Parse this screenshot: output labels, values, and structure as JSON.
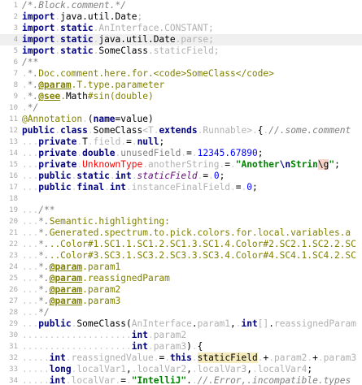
{
  "editor": {
    "current_line": 4,
    "lines": [
      {
        "n": "1",
        "tokens": [
          [
            "c-cmt",
            "/*.Block.comment.*/"
          ]
        ]
      },
      {
        "n": "2",
        "tokens": [
          [
            "c-kw",
            "import"
          ],
          [
            "c-dots",
            "."
          ],
          [
            "c-plain",
            "java.util.Date"
          ],
          [
            "c-fade",
            ";"
          ]
        ]
      },
      {
        "n": "3",
        "tokens": [
          [
            "c-kw",
            "import"
          ],
          [
            "c-dots",
            "."
          ],
          [
            "c-kw",
            "static"
          ],
          [
            "c-dots",
            "."
          ],
          [
            "c-fade",
            "AnInterface.CONSTANT;"
          ]
        ]
      },
      {
        "n": "4",
        "tokens": [
          [
            "c-kw",
            "import"
          ],
          [
            "c-dots",
            "."
          ],
          [
            "c-kw",
            "static"
          ],
          [
            "c-dots",
            "."
          ],
          [
            "c-plain",
            "java.util.Date"
          ],
          [
            "c-fade",
            "."
          ],
          [
            "c-fade",
            "parse;"
          ]
        ]
      },
      {
        "n": "5",
        "tokens": [
          [
            "c-kw",
            "import"
          ],
          [
            "c-dots",
            "."
          ],
          [
            "c-kw",
            "static"
          ],
          [
            "c-dots",
            "."
          ],
          [
            "c-plain",
            "SomeClass"
          ],
          [
            "c-fade",
            "."
          ],
          [
            "c-fade",
            "staticField;"
          ]
        ]
      },
      {
        "n": "6",
        "tokens": [
          [
            "c-cmt",
            "/**"
          ]
        ]
      },
      {
        "n": "7",
        "tokens": [
          [
            "c-dots",
            "."
          ],
          [
            "c-cmt",
            "*."
          ],
          [
            "c-doc",
            "Doc.comment.here.for.<code>SomeClass</code>"
          ]
        ]
      },
      {
        "n": "8",
        "tokens": [
          [
            "c-dots",
            "."
          ],
          [
            "c-cmt",
            "*."
          ],
          [
            "c-doctag",
            "@param"
          ],
          [
            "c-doc",
            "."
          ],
          [
            "c-doc",
            "T.type.parameter"
          ]
        ]
      },
      {
        "n": "9",
        "tokens": [
          [
            "c-dots",
            "."
          ],
          [
            "c-cmt",
            "*."
          ],
          [
            "c-doctag",
            "@see"
          ],
          [
            "c-doc",
            "."
          ],
          [
            "c-plain",
            "Math"
          ],
          [
            "c-doc",
            "#"
          ],
          [
            "c-doc",
            "sin(double)"
          ]
        ]
      },
      {
        "n": "10",
        "tokens": [
          [
            "c-dots",
            "."
          ],
          [
            "c-cmt",
            "*/"
          ]
        ]
      },
      {
        "n": "11",
        "tokens": [
          [
            "c-anno",
            "@Annotation"
          ],
          [
            "c-dots",
            "."
          ],
          [
            "c-plain",
            "("
          ],
          [
            "c-kw",
            "name"
          ],
          [
            "c-plain",
            "=value)"
          ]
        ]
      },
      {
        "n": "12",
        "tokens": [
          [
            "c-kw",
            "public"
          ],
          [
            "c-dots",
            "."
          ],
          [
            "c-kw",
            "class"
          ],
          [
            "c-dots",
            "."
          ],
          [
            "c-plain",
            "SomeClass"
          ],
          [
            "c-fade",
            "<T"
          ],
          [
            "c-dots",
            "."
          ],
          [
            "c-kw",
            "extends"
          ],
          [
            "c-dots",
            "."
          ],
          [
            "c-fade",
            "Runnable>"
          ],
          [
            "c-dots",
            "."
          ],
          [
            "c-plain",
            "{"
          ],
          [
            "c-dots",
            "."
          ],
          [
            "c-cmt",
            "//.some.comment"
          ]
        ]
      },
      {
        "n": "13",
        "tokens": [
          [
            "c-dots",
            "..."
          ],
          [
            "c-kw",
            "private"
          ],
          [
            "c-dots",
            "."
          ],
          [
            "c-plain",
            "T"
          ],
          [
            "c-dots",
            "."
          ],
          [
            "c-fade",
            "field"
          ],
          [
            "c-dots",
            "."
          ],
          [
            "c-plain",
            "="
          ],
          [
            "c-dots",
            "."
          ],
          [
            "c-kw",
            "null"
          ],
          [
            "c-plain",
            ";"
          ]
        ]
      },
      {
        "n": "14",
        "tokens": [
          [
            "c-dots",
            "..."
          ],
          [
            "c-kw",
            "private"
          ],
          [
            "c-dots",
            "."
          ],
          [
            "c-kw",
            "double"
          ],
          [
            "c-dots",
            "."
          ],
          [
            "c-unused",
            "unusedField"
          ],
          [
            "c-dots",
            "."
          ],
          [
            "c-plain",
            "="
          ],
          [
            "c-dots",
            "."
          ],
          [
            "c-num",
            "12345.67890"
          ],
          [
            "c-plain",
            ";"
          ]
        ]
      },
      {
        "n": "15",
        "tokens": [
          [
            "c-dots",
            "..."
          ],
          [
            "c-kw",
            "private"
          ],
          [
            "c-dots",
            "."
          ],
          [
            "c-err",
            "UnknownType"
          ],
          [
            "c-dots",
            "."
          ],
          [
            "c-fade",
            "anotherString"
          ],
          [
            "c-dots",
            "."
          ],
          [
            "c-plain",
            "="
          ],
          [
            "c-dots",
            "."
          ],
          [
            "c-str",
            "\"Another"
          ],
          [
            "c-escape",
            "\\n"
          ],
          [
            "c-str",
            "Strin"
          ],
          [
            "c-err-hl",
            "\\g"
          ],
          [
            "c-str",
            "\""
          ],
          [
            "c-plain",
            ";"
          ]
        ]
      },
      {
        "n": "16",
        "tokens": [
          [
            "c-dots",
            "..."
          ],
          [
            "c-kw",
            "public"
          ],
          [
            "c-dots",
            "."
          ],
          [
            "c-kw",
            "static"
          ],
          [
            "c-dots",
            "."
          ],
          [
            "c-kw",
            "int"
          ],
          [
            "c-dots",
            "."
          ],
          [
            "c-static",
            "staticField"
          ],
          [
            "c-dots",
            "."
          ],
          [
            "c-plain",
            "="
          ],
          [
            "c-dots",
            "."
          ],
          [
            "c-num",
            "0"
          ],
          [
            "c-plain",
            ";"
          ]
        ]
      },
      {
        "n": "17",
        "tokens": [
          [
            "c-dots",
            "..."
          ],
          [
            "c-kw",
            "public"
          ],
          [
            "c-dots",
            "."
          ],
          [
            "c-kw",
            "final"
          ],
          [
            "c-dots",
            "."
          ],
          [
            "c-kw",
            "int"
          ],
          [
            "c-dots",
            "."
          ],
          [
            "c-fade",
            "instanceFinalField"
          ],
          [
            "c-dots",
            "."
          ],
          [
            "c-plain",
            "="
          ],
          [
            "c-dots",
            "."
          ],
          [
            "c-num",
            "0"
          ],
          [
            "c-plain",
            ";"
          ]
        ]
      },
      {
        "n": "18",
        "tokens": []
      },
      {
        "n": "19",
        "tokens": [
          [
            "c-dots",
            "..."
          ],
          [
            "c-cmt",
            "/**"
          ]
        ]
      },
      {
        "n": "20",
        "tokens": [
          [
            "c-dots",
            "..."
          ],
          [
            "c-cmt",
            "*."
          ],
          [
            "c-doc",
            "Semantic.highlighting:"
          ]
        ]
      },
      {
        "n": "21",
        "tokens": [
          [
            "c-dots",
            "..."
          ],
          [
            "c-cmt",
            "*."
          ],
          [
            "c-doc",
            "Generated.spectrum.to.pick.colors.for.local.variables.a"
          ]
        ]
      },
      {
        "n": "22",
        "tokens": [
          [
            "c-dots",
            "..."
          ],
          [
            "c-cmt",
            "*."
          ],
          [
            "c-doc",
            "..Color#1.SC1.1.SC1.2.SC1.3.SC1.4.Color#2.SC2.1.SC2.2.SC"
          ]
        ]
      },
      {
        "n": "23",
        "tokens": [
          [
            "c-dots",
            "..."
          ],
          [
            "c-cmt",
            "*."
          ],
          [
            "c-doc",
            "..Color#3.SC3.1.SC3.2.SC3.3.SC3.4.Color#4.SC4.1.SC4.2.SC"
          ]
        ]
      },
      {
        "n": "24",
        "tokens": [
          [
            "c-dots",
            "..."
          ],
          [
            "c-cmt",
            "*."
          ],
          [
            "c-doctag",
            "@param"
          ],
          [
            "c-doc",
            "."
          ],
          [
            "c-doc",
            "param1"
          ]
        ]
      },
      {
        "n": "25",
        "tokens": [
          [
            "c-dots",
            "..."
          ],
          [
            "c-cmt",
            "*."
          ],
          [
            "c-doctag",
            "@param"
          ],
          [
            "c-doc",
            "."
          ],
          [
            "c-doc",
            "reassignedParam"
          ]
        ]
      },
      {
        "n": "26",
        "tokens": [
          [
            "c-dots",
            "..."
          ],
          [
            "c-cmt",
            "*."
          ],
          [
            "c-doctag",
            "@param"
          ],
          [
            "c-doc",
            "."
          ],
          [
            "c-doc",
            "param2"
          ]
        ]
      },
      {
        "n": "27",
        "tokens": [
          [
            "c-dots",
            "..."
          ],
          [
            "c-cmt",
            "*."
          ],
          [
            "c-doctag",
            "@param"
          ],
          [
            "c-doc",
            "."
          ],
          [
            "c-doc",
            "param3"
          ]
        ]
      },
      {
        "n": "28",
        "tokens": [
          [
            "c-dots",
            "..."
          ],
          [
            "c-cmt",
            "*/"
          ]
        ]
      },
      {
        "n": "29",
        "tokens": [
          [
            "c-dots",
            "..."
          ],
          [
            "c-kw",
            "public"
          ],
          [
            "c-dots",
            "."
          ],
          [
            "c-plain",
            "SomeClass"
          ],
          [
            "c-plain",
            "("
          ],
          [
            "c-fade",
            "AnInterface"
          ],
          [
            "c-plain",
            "."
          ],
          [
            "c-fade",
            "param1"
          ],
          [
            "c-plain",
            ","
          ],
          [
            "c-dots",
            "."
          ],
          [
            "c-kw",
            "int"
          ],
          [
            "c-fade",
            "[]"
          ],
          [
            "c-plain",
            "."
          ],
          [
            "c-fade",
            "reassignedParam"
          ]
        ]
      },
      {
        "n": "30",
        "tokens": [
          [
            "c-dots",
            "...................."
          ],
          [
            "c-kw",
            "int"
          ],
          [
            "c-dots",
            "."
          ],
          [
            "c-fade",
            "param2"
          ]
        ]
      },
      {
        "n": "31",
        "tokens": [
          [
            "c-dots",
            "...................."
          ],
          [
            "c-kw",
            "int"
          ],
          [
            "c-dots",
            "."
          ],
          [
            "c-fade",
            "param3"
          ],
          [
            "c-plain",
            ")"
          ],
          [
            "c-dots",
            "."
          ],
          [
            "c-plain",
            "{"
          ]
        ]
      },
      {
        "n": "32",
        "tokens": [
          [
            "c-dots",
            "....."
          ],
          [
            "c-kw",
            "int"
          ],
          [
            "c-dots",
            "."
          ],
          [
            "c-fade",
            "reassignedValue"
          ],
          [
            "c-dots",
            "."
          ],
          [
            "c-plain",
            "="
          ],
          [
            "c-dots",
            "."
          ],
          [
            "c-kw",
            "this"
          ],
          [
            "c-dots",
            "."
          ],
          [
            "c-hl",
            "staticField"
          ],
          [
            "c-dots",
            "."
          ],
          [
            "c-plain",
            "+"
          ],
          [
            "c-dots",
            "."
          ],
          [
            "c-fade",
            "param2"
          ],
          [
            "c-dots",
            "."
          ],
          [
            "c-plain",
            "+"
          ],
          [
            "c-dots",
            "."
          ],
          [
            "c-fade",
            "param3"
          ]
        ]
      },
      {
        "n": "33",
        "tokens": [
          [
            "c-dots",
            "....."
          ],
          [
            "c-kw",
            "long"
          ],
          [
            "c-dots",
            "."
          ],
          [
            "c-fade",
            "localVar1"
          ],
          [
            "c-plain",
            ","
          ],
          [
            "c-dots",
            "."
          ],
          [
            "c-fade",
            "localVar2"
          ],
          [
            "c-plain",
            ","
          ],
          [
            "c-dots",
            "."
          ],
          [
            "c-fade",
            "localVar3"
          ],
          [
            "c-plain",
            ","
          ],
          [
            "c-dots",
            "."
          ],
          [
            "c-fade",
            "localVar4"
          ],
          [
            "c-plain",
            ";"
          ]
        ]
      },
      {
        "n": "34",
        "tokens": [
          [
            "c-dots",
            "....."
          ],
          [
            "c-kw",
            "int"
          ],
          [
            "c-dots",
            "."
          ],
          [
            "c-fade",
            "localVar"
          ],
          [
            "c-dots",
            "."
          ],
          [
            "c-plain",
            "="
          ],
          [
            "c-dots",
            "."
          ],
          [
            "c-str",
            "\"IntelliJ\""
          ],
          [
            "c-plain",
            "."
          ],
          [
            "c-dots",
            "."
          ],
          [
            "c-cmt",
            "//.Error,.incompatible.types"
          ]
        ]
      }
    ]
  }
}
